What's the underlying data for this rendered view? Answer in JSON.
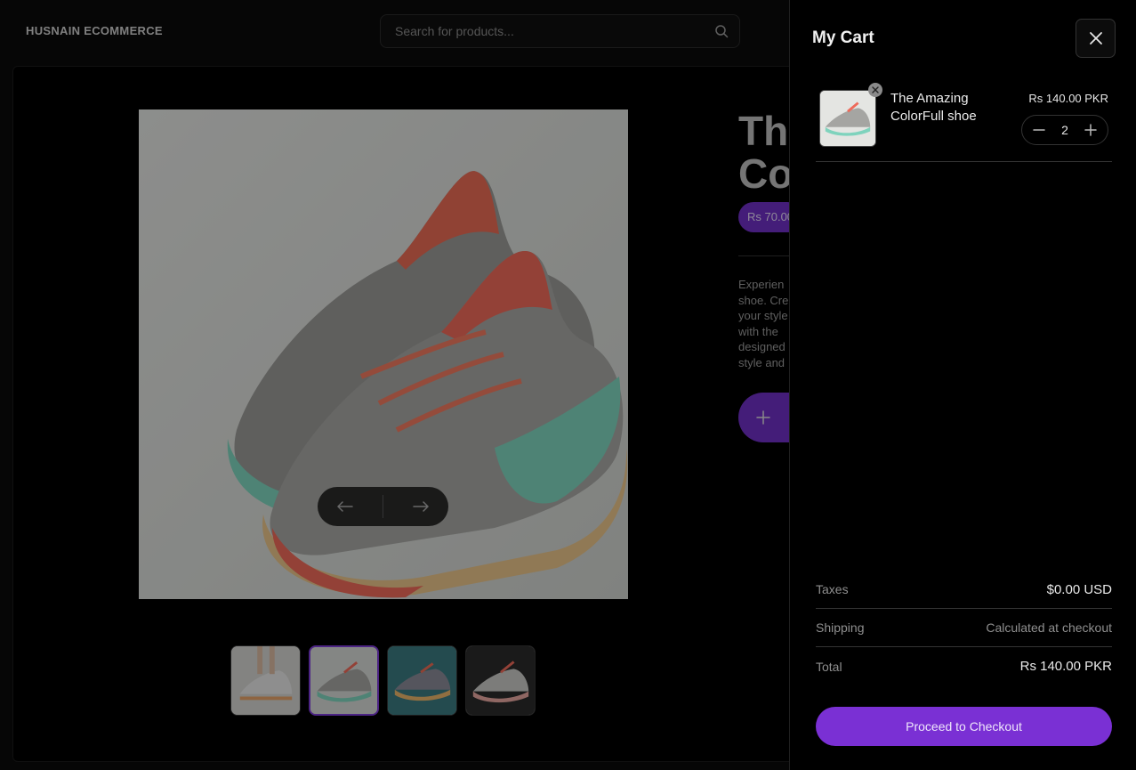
{
  "header": {
    "brand": "HUSNAIN ECOMMERCE",
    "search_placeholder": "Search for products..."
  },
  "product": {
    "title_visible": "Th\nCo",
    "price_visible": "Rs 70.00",
    "description_visible": "Experien\nshoe. Cre\nyour style\nwith the\ndesigned\nstyle and",
    "thumbnails": [
      "thumb-1",
      "thumb-2",
      "thumb-3",
      "thumb-4"
    ],
    "active_thumbnail_index": 1
  },
  "cart": {
    "title": "My Cart",
    "items": [
      {
        "name": "The Amazing ColorFull shoe",
        "price": "Rs 140.00 PKR",
        "quantity": "2"
      }
    ],
    "summary": {
      "taxes_label": "Taxes",
      "taxes_value": "$0.00 USD",
      "shipping_label": "Shipping",
      "shipping_value": "Calculated at checkout",
      "total_label": "Total",
      "total_value": "Rs 140.00 PKR"
    },
    "checkout_label": "Proceed to Checkout"
  },
  "icons": {
    "search": "search-icon",
    "close": "close-icon",
    "minus": "minus-icon",
    "plus": "plus-icon",
    "arrow_left": "arrow-left-icon",
    "arrow_right": "arrow-right-icon",
    "remove": "remove-icon"
  },
  "colors": {
    "accent": "#7a30d4",
    "background": "#000000"
  }
}
